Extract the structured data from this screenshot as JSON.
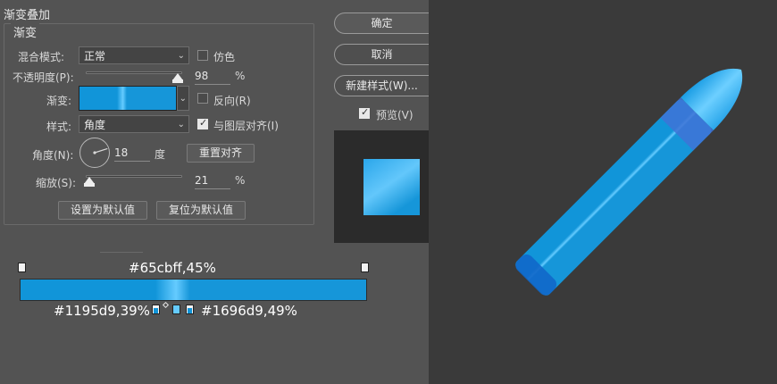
{
  "panel": {
    "title": "渐变叠加",
    "group_title": "渐变",
    "blend_mode": {
      "label": "混合模式:",
      "value": "正常"
    },
    "dither": {
      "label": "仿色",
      "checked": false
    },
    "opacity": {
      "label": "不透明度(P):",
      "value": "98",
      "unit": "%",
      "level_percent": 98
    },
    "gradient": {
      "label": "渐变:"
    },
    "reverse": {
      "label": "反向(R)",
      "checked": false
    },
    "style": {
      "label": "样式:",
      "value": "角度"
    },
    "align_with_layer": {
      "label": "与图层对齐(I)",
      "checked": true
    },
    "angle": {
      "label": "角度(N):",
      "value": "18",
      "unit": "度",
      "degrees": 18
    },
    "reset_alignment_label": "重置对齐",
    "scale": {
      "label": "缩放(S):",
      "value": "21",
      "unit": "%",
      "level_percent": 21
    },
    "set_default_label": "设置为默认值",
    "reset_default_label": "复位为默认值"
  },
  "actions": {
    "ok_label": "确定",
    "cancel_label": "取消",
    "new_style_label": "新建样式(W)...",
    "preview": {
      "label": "预览(V)",
      "checked": true
    }
  },
  "gradient_annotation": {
    "mid_stop": "#65cbff,45%",
    "left_stop": "#1195d9,39%",
    "right_stop": "#1696d9,49%"
  },
  "colors": {
    "stop_a": "#1195d9",
    "stop_mid": "#65cbff",
    "stop_b": "#1696d9"
  }
}
